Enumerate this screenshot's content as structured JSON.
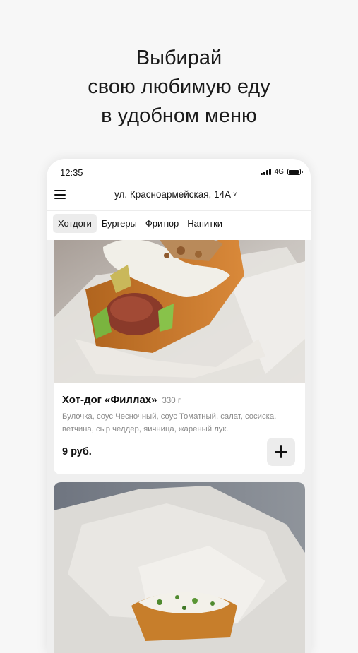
{
  "promo": {
    "line1": "Выбирай",
    "line2": "свою любимую еду",
    "line3": "в удобном меню"
  },
  "status_bar": {
    "time": "12:35",
    "network": "4G"
  },
  "header": {
    "address": "ул. Красноармейская, 14А",
    "address_chevron": "˅"
  },
  "categories": [
    {
      "label": "Хотдоги",
      "active": true
    },
    {
      "label": "Бургеры",
      "active": false
    },
    {
      "label": "Фритюр",
      "active": false
    },
    {
      "label": "Напитки",
      "active": false
    }
  ],
  "products": [
    {
      "name": "Хот-дог «Филлах»",
      "weight": "330 г",
      "description": "Булочка, соус Чесночный, соус Томатный, салат, сосиска, ветчина, сыр чеддер, яичница, жареный лук.",
      "price": "9 руб.",
      "add_icon": "plus-icon"
    }
  ],
  "colors": {
    "background": "#f7f7f7",
    "card": "#ffffff",
    "chip": "#ececec",
    "muted_text": "#8a8a8a"
  }
}
